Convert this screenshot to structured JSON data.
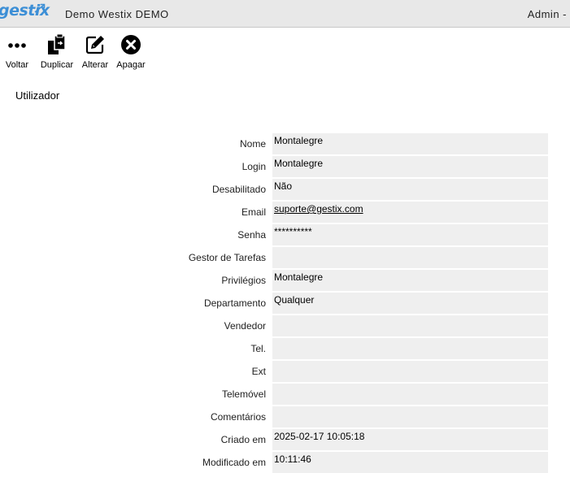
{
  "header": {
    "logo_text": "gestix",
    "app_title": "Demo Westix DEMO",
    "user_label": "Admin -"
  },
  "toolbar": {
    "voltar": "Voltar",
    "duplicar": "Duplicar",
    "alterar": "Alterar",
    "apagar": "Apagar"
  },
  "section_title": "Utilizador",
  "fields": [
    {
      "label": "Nome",
      "value": "Montalegre"
    },
    {
      "label": "Login",
      "value": "Montalegre"
    },
    {
      "label": "Desabilitado",
      "value": "Não"
    },
    {
      "label": "Email",
      "value": "suporte@gestix.com"
    },
    {
      "label": "Senha",
      "value": "**********"
    },
    {
      "label": "Gestor de Tarefas",
      "value": ""
    },
    {
      "label": "Privilégios",
      "value": "Montalegre"
    },
    {
      "label": "Departamento",
      "value": "Qualquer"
    },
    {
      "label": "Vendedor",
      "value": ""
    },
    {
      "label": "Tel.",
      "value": ""
    },
    {
      "label": "Ext",
      "value": ""
    },
    {
      "label": "Telemóvel",
      "value": ""
    },
    {
      "label": "Comentários",
      "value": ""
    },
    {
      "label": "Criado em",
      "value": "2025-02-17 10:05:18"
    },
    {
      "label": "Modificado em",
      "value": "10:11:46"
    }
  ],
  "colors": {
    "logo": "#3d8fd6",
    "header_bg": "#e8e8e8",
    "field_bg": "#efefef"
  },
  "icons": {
    "voltar": "more-dots-icon",
    "duplicar": "duplicate-icon",
    "alterar": "edit-icon",
    "apagar": "delete-circle-icon"
  }
}
